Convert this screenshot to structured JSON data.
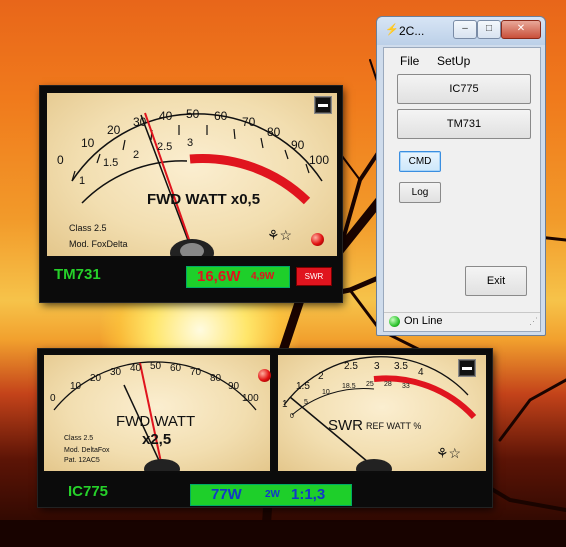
{
  "meter1": {
    "scale_watt": [
      "0",
      "10",
      "20",
      "30",
      "40",
      "50",
      "60",
      "70",
      "80",
      "90",
      "100"
    ],
    "scale_swr": [
      "1",
      "1.5",
      "2",
      "2.5",
      "3"
    ],
    "title": "FWD WATT x0,5",
    "class_text": "Class 2.5",
    "model_text": "Mod. FoxDelta",
    "rig_name": "TM731",
    "readout_main": "16,6W",
    "readout_sub": "4,9W",
    "swr_button": "SWR",
    "minimize": "minimize"
  },
  "meter2": {
    "scale_watt": [
      "0",
      "10",
      "20",
      "30",
      "40",
      "50",
      "60",
      "70",
      "80",
      "90",
      "100"
    ],
    "title_line1": "FWD WATT",
    "title_line2": "x2,5",
    "class_text": "Class 2.5",
    "model_text": "Mod. DeltaFox",
    "pat_text": "Pat. 12AC5",
    "swr_scale": [
      "1",
      "1.5",
      "2",
      "2.5",
      "3",
      "3.5",
      "4"
    ],
    "ref_scale": [
      "0",
      "5",
      "10",
      "18.5",
      "25",
      "28",
      "33"
    ],
    "swr_title": "SWR",
    "swr_sub": "REF WATT %",
    "rig_name": "IC775",
    "readout_main": "77W",
    "readout_sub": "2W",
    "readout_swr": "1:1,3"
  },
  "app": {
    "title": "2C...",
    "menu_file": "File",
    "menu_setup": "SetUp",
    "btn_ic775": "IC775",
    "btn_tm731": "TM731",
    "btn_cmd": "CMD",
    "btn_log": "Log",
    "btn_exit": "Exit",
    "status": "On Line",
    "colors": {
      "status_led": "#2ec42e",
      "cmd_border": "#3a8ee0"
    }
  },
  "colors": {
    "needle": "#e0141e",
    "readout_bg": "#1ecf2a",
    "rig_text": "#26d12a",
    "red_arc": "#e0141e"
  }
}
